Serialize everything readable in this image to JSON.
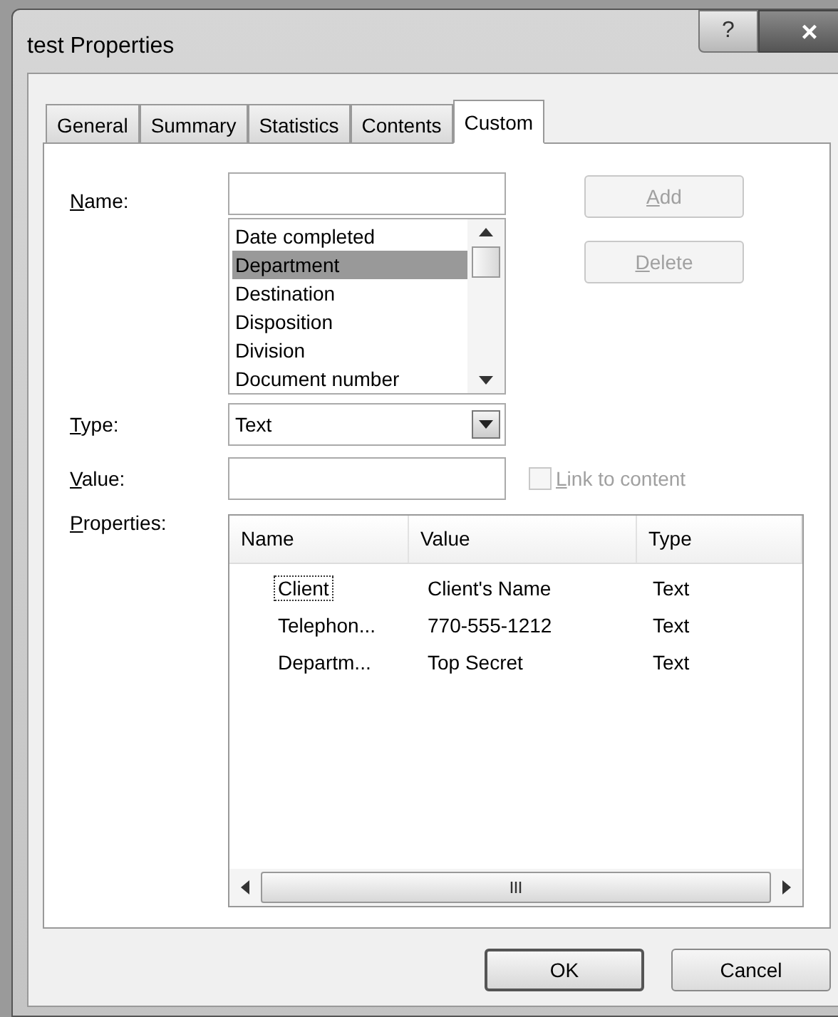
{
  "window": {
    "title": "test Properties",
    "help_button": "?",
    "close_button": "×"
  },
  "tabs": [
    {
      "label": "General",
      "selected": false
    },
    {
      "label": "Summary",
      "selected": false
    },
    {
      "label": "Statistics",
      "selected": false
    },
    {
      "label": "Contents",
      "selected": false
    },
    {
      "label": "Custom",
      "selected": true
    }
  ],
  "name_field": {
    "label": "Name:"
  },
  "name_list": [
    {
      "label": "Date completed",
      "selected": false
    },
    {
      "label": "Department",
      "selected": true
    },
    {
      "label": "Destination",
      "selected": false
    },
    {
      "label": "Disposition",
      "selected": false
    },
    {
      "label": "Division",
      "selected": false
    },
    {
      "label": "Document number",
      "selected": false
    }
  ],
  "add_button": {
    "label": "Add",
    "disabled": true
  },
  "delete_button": {
    "label": "Delete",
    "disabled": true
  },
  "type_field": {
    "label": "Type:",
    "value": "Text"
  },
  "value_field": {
    "label": "Value:"
  },
  "link_to_content": {
    "label": "Link to content",
    "checked": false,
    "disabled": true
  },
  "properties": {
    "label": "Properties:",
    "columns": [
      "Name",
      "Value",
      "Type"
    ],
    "rows": [
      {
        "cells": [
          "Client",
          "Client's Name",
          "Text"
        ],
        "focused": true
      },
      {
        "cells": [
          "Telephon...",
          "770-555-1212",
          "Text"
        ],
        "focused": false
      },
      {
        "cells": [
          "Departm...",
          "Top Secret",
          "Text"
        ],
        "focused": false
      }
    ]
  },
  "buttons": [
    {
      "label": "OK",
      "default": true
    },
    {
      "label": "Cancel",
      "default": false
    }
  ]
}
